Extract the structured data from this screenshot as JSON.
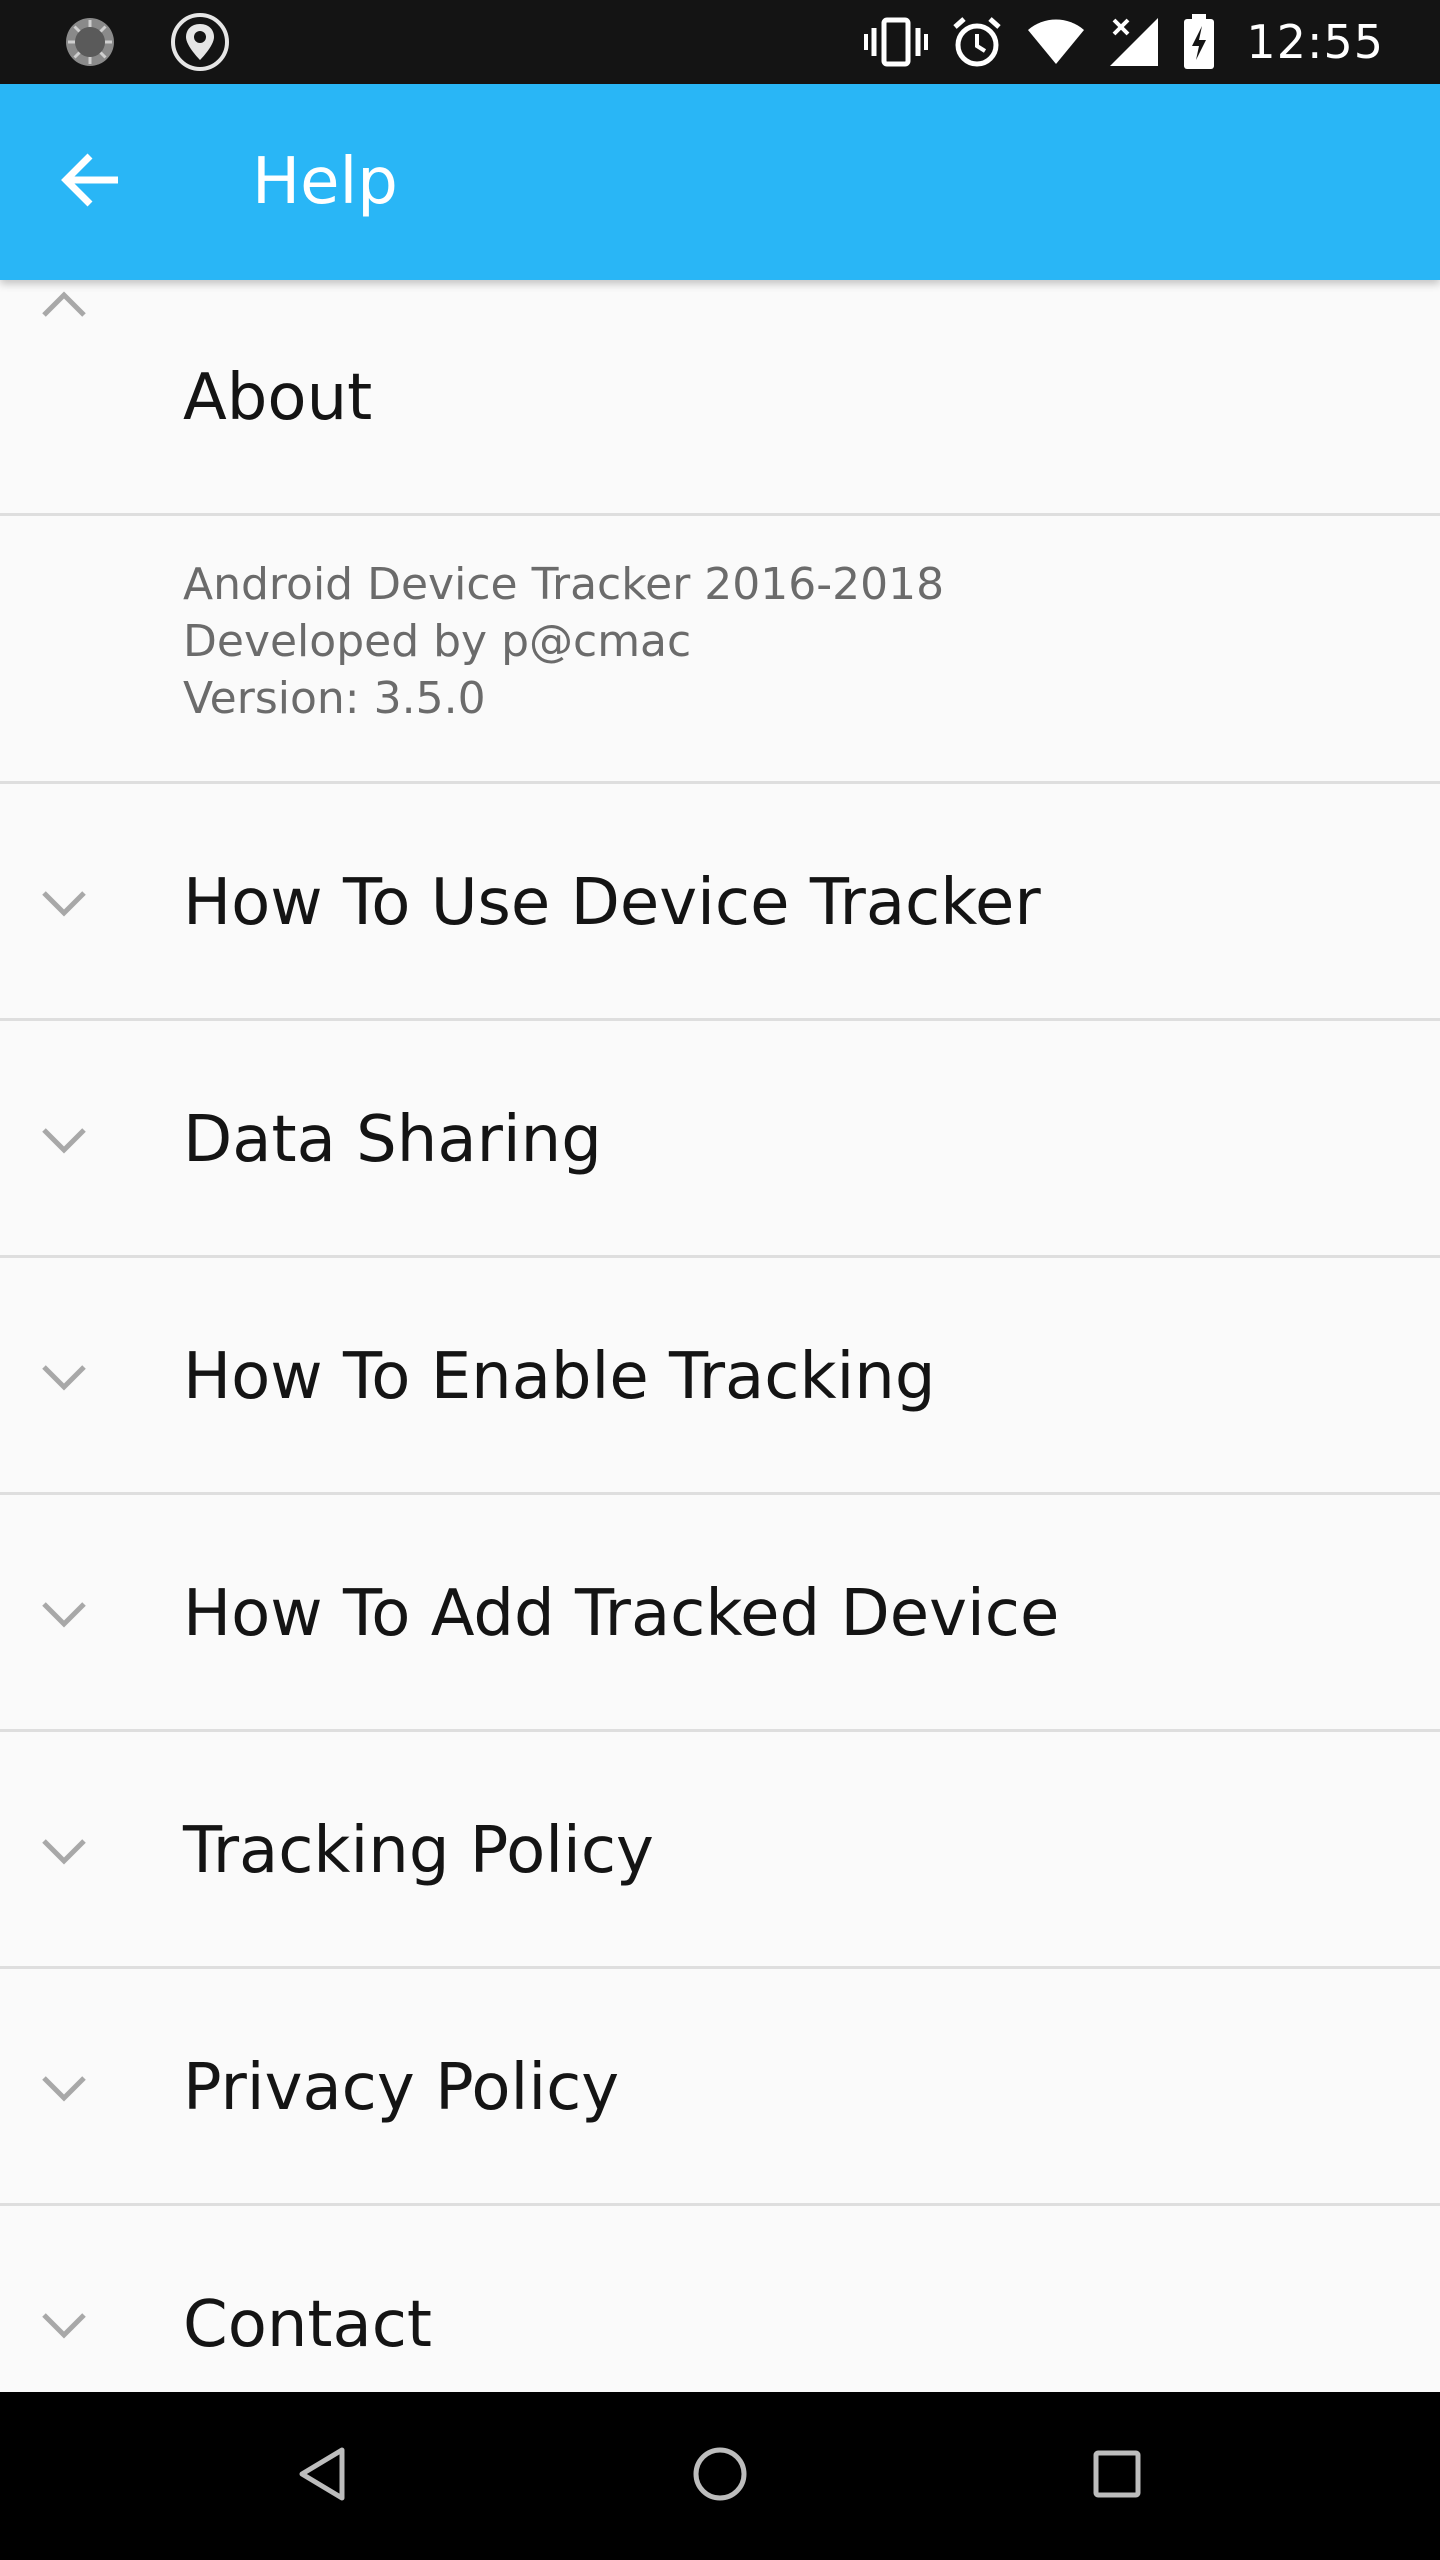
{
  "status_bar": {
    "time": "12:55",
    "left_icons": [
      "sync-spinner-icon",
      "location-pin-icon"
    ],
    "right_icons": [
      "vibrate-icon",
      "alarm-icon",
      "wifi-icon",
      "signal-icon",
      "battery-charging-icon"
    ]
  },
  "app_bar": {
    "title": "Help",
    "back_icon": "arrow-left-icon",
    "color": "#29b6f6"
  },
  "sections": [
    {
      "title": "About",
      "expanded": true,
      "body_lines": [
        "Android Device Tracker 2016-2018",
        "Developed by p@cmac",
        "Version: 3.5.0"
      ]
    },
    {
      "title": "How To Use Device Tracker",
      "expanded": false
    },
    {
      "title": "Data Sharing",
      "expanded": false
    },
    {
      "title": "How To Enable Tracking",
      "expanded": false
    },
    {
      "title": "How To Add Tracked Device",
      "expanded": false
    },
    {
      "title": "Tracking Policy",
      "expanded": false
    },
    {
      "title": "Privacy Policy",
      "expanded": false
    },
    {
      "title": "Contact",
      "expanded": false
    }
  ],
  "nav_bar": {
    "icons": [
      "back-triangle-icon",
      "home-circle-icon",
      "recents-square-icon"
    ]
  }
}
